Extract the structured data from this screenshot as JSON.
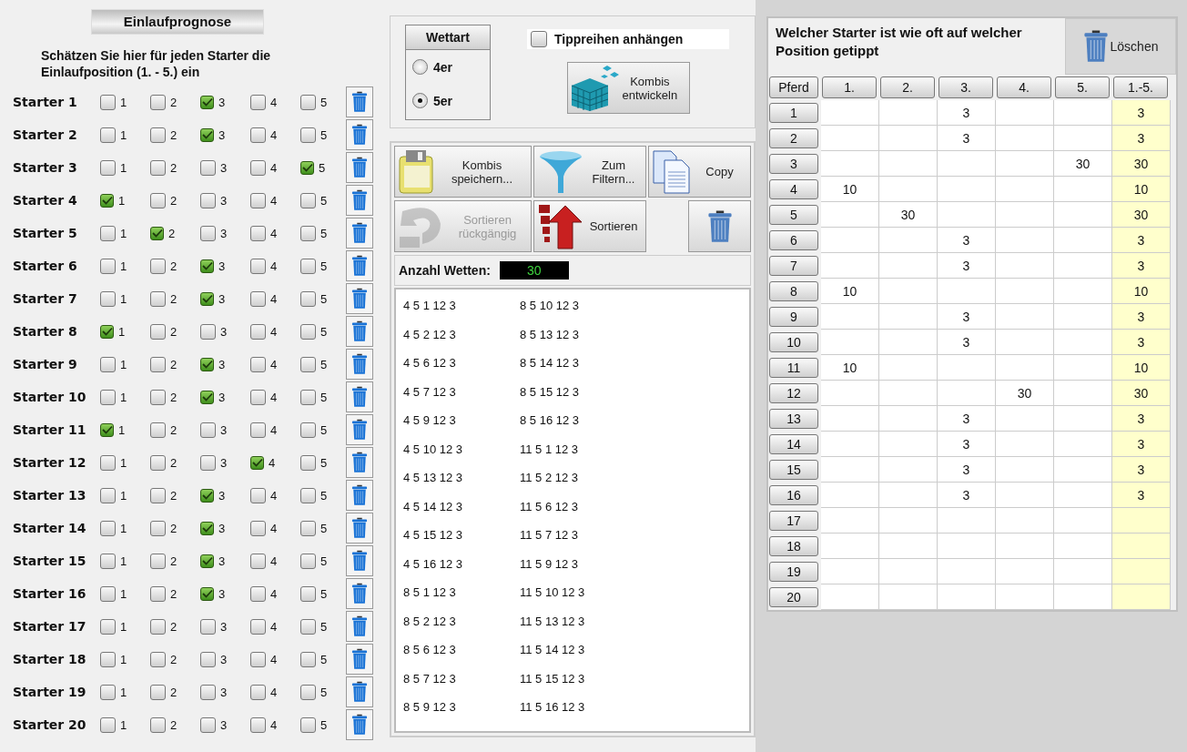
{
  "prognosis": {
    "title": "Einlaufprognose",
    "instruction": "Schätzen Sie hier für jeden Starter die Einlaufposition (1. - 5.) ein",
    "starters": [
      {
        "name": "Starter 1",
        "positions": [
          {
            "label": "1",
            "checked": false
          },
          {
            "label": "2",
            "checked": false
          },
          {
            "label": "3",
            "checked": true
          },
          {
            "label": "4",
            "checked": false
          },
          {
            "label": "5",
            "checked": false
          }
        ]
      },
      {
        "name": "Starter 2",
        "positions": [
          {
            "label": "1",
            "checked": false
          },
          {
            "label": "2",
            "checked": false
          },
          {
            "label": "3",
            "checked": true
          },
          {
            "label": "4",
            "checked": false
          },
          {
            "label": "5",
            "checked": false
          }
        ]
      },
      {
        "name": "Starter 3",
        "positions": [
          {
            "label": "1",
            "checked": false
          },
          {
            "label": "2",
            "checked": false
          },
          {
            "label": "3",
            "checked": false
          },
          {
            "label": "4",
            "checked": false
          },
          {
            "label": "5",
            "checked": true
          }
        ]
      },
      {
        "name": "Starter 4",
        "positions": [
          {
            "label": "1",
            "checked": true
          },
          {
            "label": "2",
            "checked": false
          },
          {
            "label": "3",
            "checked": false
          },
          {
            "label": "4",
            "checked": false
          },
          {
            "label": "5",
            "checked": false
          }
        ]
      },
      {
        "name": "Starter 5",
        "positions": [
          {
            "label": "1",
            "checked": false
          },
          {
            "label": "2",
            "checked": true
          },
          {
            "label": "3",
            "checked": false
          },
          {
            "label": "4",
            "checked": false
          },
          {
            "label": "5",
            "checked": false
          }
        ]
      },
      {
        "name": "Starter 6",
        "positions": [
          {
            "label": "1",
            "checked": false
          },
          {
            "label": "2",
            "checked": false
          },
          {
            "label": "3",
            "checked": true
          },
          {
            "label": "4",
            "checked": false
          },
          {
            "label": "5",
            "checked": false
          }
        ]
      },
      {
        "name": "Starter 7",
        "positions": [
          {
            "label": "1",
            "checked": false
          },
          {
            "label": "2",
            "checked": false
          },
          {
            "label": "3",
            "checked": true
          },
          {
            "label": "4",
            "checked": false
          },
          {
            "label": "5",
            "checked": false
          }
        ]
      },
      {
        "name": "Starter 8",
        "positions": [
          {
            "label": "1",
            "checked": true
          },
          {
            "label": "2",
            "checked": false
          },
          {
            "label": "3",
            "checked": false
          },
          {
            "label": "4",
            "checked": false
          },
          {
            "label": "5",
            "checked": false
          }
        ]
      },
      {
        "name": "Starter 9",
        "positions": [
          {
            "label": "1",
            "checked": false
          },
          {
            "label": "2",
            "checked": false
          },
          {
            "label": "3",
            "checked": true
          },
          {
            "label": "4",
            "checked": false
          },
          {
            "label": "5",
            "checked": false
          }
        ]
      },
      {
        "name": "Starter 10",
        "positions": [
          {
            "label": "1",
            "checked": false
          },
          {
            "label": "2",
            "checked": false
          },
          {
            "label": "3",
            "checked": true
          },
          {
            "label": "4",
            "checked": false
          },
          {
            "label": "5",
            "checked": false
          }
        ]
      },
      {
        "name": "Starter 11",
        "positions": [
          {
            "label": "1",
            "checked": true
          },
          {
            "label": "2",
            "checked": false
          },
          {
            "label": "3",
            "checked": false
          },
          {
            "label": "4",
            "checked": false
          },
          {
            "label": "5",
            "checked": false
          }
        ]
      },
      {
        "name": "Starter 12",
        "positions": [
          {
            "label": "1",
            "checked": false
          },
          {
            "label": "2",
            "checked": false
          },
          {
            "label": "3",
            "checked": false
          },
          {
            "label": "4",
            "checked": true
          },
          {
            "label": "5",
            "checked": false
          }
        ]
      },
      {
        "name": "Starter 13",
        "positions": [
          {
            "label": "1",
            "checked": false
          },
          {
            "label": "2",
            "checked": false
          },
          {
            "label": "3",
            "checked": true
          },
          {
            "label": "4",
            "checked": false
          },
          {
            "label": "5",
            "checked": false
          }
        ]
      },
      {
        "name": "Starter 14",
        "positions": [
          {
            "label": "1",
            "checked": false
          },
          {
            "label": "2",
            "checked": false
          },
          {
            "label": "3",
            "checked": true
          },
          {
            "label": "4",
            "checked": false
          },
          {
            "label": "5",
            "checked": false
          }
        ]
      },
      {
        "name": "Starter 15",
        "positions": [
          {
            "label": "1",
            "checked": false
          },
          {
            "label": "2",
            "checked": false
          },
          {
            "label": "3",
            "checked": true
          },
          {
            "label": "4",
            "checked": false
          },
          {
            "label": "5",
            "checked": false
          }
        ]
      },
      {
        "name": "Starter 16",
        "positions": [
          {
            "label": "1",
            "checked": false
          },
          {
            "label": "2",
            "checked": false
          },
          {
            "label": "3",
            "checked": true
          },
          {
            "label": "4",
            "checked": false
          },
          {
            "label": "5",
            "checked": false
          }
        ]
      },
      {
        "name": "Starter 17",
        "positions": [
          {
            "label": "1",
            "checked": false
          },
          {
            "label": "2",
            "checked": false
          },
          {
            "label": "3",
            "checked": false
          },
          {
            "label": "4",
            "checked": false
          },
          {
            "label": "5",
            "checked": false
          }
        ]
      },
      {
        "name": "Starter 18",
        "positions": [
          {
            "label": "1",
            "checked": false
          },
          {
            "label": "2",
            "checked": false
          },
          {
            "label": "3",
            "checked": false
          },
          {
            "label": "4",
            "checked": false
          },
          {
            "label": "5",
            "checked": false
          }
        ]
      },
      {
        "name": "Starter 19",
        "positions": [
          {
            "label": "1",
            "checked": false
          },
          {
            "label": "2",
            "checked": false
          },
          {
            "label": "3",
            "checked": false
          },
          {
            "label": "4",
            "checked": false
          },
          {
            "label": "5",
            "checked": false
          }
        ]
      },
      {
        "name": "Starter 20",
        "positions": [
          {
            "label": "1",
            "checked": false
          },
          {
            "label": "2",
            "checked": false
          },
          {
            "label": "3",
            "checked": false
          },
          {
            "label": "4",
            "checked": false
          },
          {
            "label": "5",
            "checked": false
          }
        ]
      }
    ]
  },
  "bet_type": {
    "title": "Wettart",
    "options": [
      {
        "label": "4er",
        "selected": false
      },
      {
        "label": "5er",
        "selected": true
      }
    ]
  },
  "append_checkbox": {
    "label": "Tippreihen anhängen",
    "checked": false
  },
  "develop_button": {
    "lines": [
      "Kombis",
      "entwickeln"
    ]
  },
  "toolbar": [
    {
      "kind": "save",
      "lines": [
        "Kombis",
        "speichern..."
      ],
      "disabled": false
    },
    {
      "kind": "filter",
      "lines": [
        "Zum",
        "Filtern..."
      ],
      "disabled": false
    },
    {
      "kind": "copy",
      "lines": [
        "Copy"
      ],
      "disabled": false
    },
    {
      "kind": "undo",
      "lines": [
        "Sortieren",
        "rückgängig"
      ],
      "disabled": true
    },
    {
      "kind": "sort",
      "lines": [
        "Sortieren"
      ],
      "disabled": false
    },
    {
      "kind": "delete",
      "disabled": false
    }
  ],
  "bet_count": {
    "label": "Anzahl Wetten:",
    "value": "30"
  },
  "combinations": [
    "4 5 1 12 3",
    "4 5 2 12 3",
    "4 5 6 12 3",
    "4 5 7 12 3",
    "4 5 9 12 3",
    "4 5 10 12 3",
    "4 5 13 12 3",
    "4 5 14 12 3",
    "4 5 15 12 3",
    "4 5 16 12 3",
    "8 5 1 12 3",
    "8 5 2 12 3",
    "8 5 6 12 3",
    "8 5 7 12 3",
    "8 5 9 12 3",
    "8 5 10 12 3",
    "8 5 13 12 3",
    "8 5 14 12 3",
    "8 5 15 12 3",
    "8 5 16 12 3",
    "11 5 1 12 3",
    "11 5 2 12 3",
    "11 5 6 12 3",
    "11 5 7 12 3",
    "11 5 9 12 3",
    "11 5 10 12 3",
    "11 5 13 12 3",
    "11 5 14 12 3",
    "11 5 15 12 3",
    "11 5 16 12 3"
  ],
  "stats": {
    "title": "Welcher Starter ist wie oft auf welcher Position getippt",
    "clear_button": "Löschen",
    "columns": [
      "Pferd",
      "1.",
      "2.",
      "3.",
      "4.",
      "5.",
      "1.-5."
    ],
    "rows": [
      {
        "cells": [
          "1",
          "",
          "",
          "3",
          "",
          "",
          "3"
        ]
      },
      {
        "cells": [
          "2",
          "",
          "",
          "3",
          "",
          "",
          "3"
        ]
      },
      {
        "cells": [
          "3",
          "",
          "",
          "",
          "",
          "30",
          "30"
        ]
      },
      {
        "cells": [
          "4",
          "10",
          "",
          "",
          "",
          "",
          "10"
        ]
      },
      {
        "cells": [
          "5",
          "",
          "30",
          "",
          "",
          "",
          "30"
        ]
      },
      {
        "cells": [
          "6",
          "",
          "",
          "3",
          "",
          "",
          "3"
        ]
      },
      {
        "cells": [
          "7",
          "",
          "",
          "3",
          "",
          "",
          "3"
        ]
      },
      {
        "cells": [
          "8",
          "10",
          "",
          "",
          "",
          "",
          "10"
        ]
      },
      {
        "cells": [
          "9",
          "",
          "",
          "3",
          "",
          "",
          "3"
        ]
      },
      {
        "cells": [
          "10",
          "",
          "",
          "3",
          "",
          "",
          "3"
        ]
      },
      {
        "cells": [
          "11",
          "10",
          "",
          "",
          "",
          "",
          "10"
        ]
      },
      {
        "cells": [
          "12",
          "",
          "",
          "",
          "30",
          "",
          "30"
        ]
      },
      {
        "cells": [
          "13",
          "",
          "",
          "3",
          "",
          "",
          "3"
        ]
      },
      {
        "cells": [
          "14",
          "",
          "",
          "3",
          "",
          "",
          "3"
        ]
      },
      {
        "cells": [
          "15",
          "",
          "",
          "3",
          "",
          "",
          "3"
        ]
      },
      {
        "cells": [
          "16",
          "",
          "",
          "3",
          "",
          "",
          "3"
        ]
      },
      {
        "cells": [
          "17",
          "",
          "",
          "",
          "",
          "",
          ""
        ]
      },
      {
        "cells": [
          "18",
          "",
          "",
          "",
          "",
          "",
          ""
        ]
      },
      {
        "cells": [
          "19",
          "",
          "",
          "",
          "",
          "",
          ""
        ]
      },
      {
        "cells": [
          "20",
          "",
          "",
          "",
          "",
          "",
          ""
        ]
      }
    ]
  }
}
